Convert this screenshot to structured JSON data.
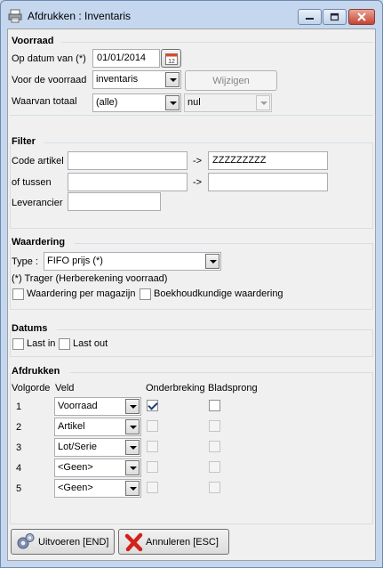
{
  "window": {
    "title": "Afdrukken : Inventaris",
    "minimize_icon": "minimize-icon",
    "maximize_icon": "maximize-icon",
    "close_icon": "close-icon"
  },
  "voorraad": {
    "title": "Voorraad",
    "op_datum_label": "Op datum van (*)",
    "op_datum_value": "01/01/2014",
    "voor_label": "Voor de voorraad",
    "voor_value": "inventaris",
    "wijzigen_label": "Wijzigen",
    "waarvan_label": "Waarvan totaal",
    "waarvan_value": "(alle)",
    "waarvan_op_value": "nul"
  },
  "filter": {
    "title": "Filter",
    "code_label": "Code artikel",
    "code_from": "",
    "arrow": "->",
    "code_to": "ZZZZZZZZZ",
    "tussen_label": "of tussen",
    "tussen_from": "",
    "tussen_to": "",
    "leverancier_label": "Leverancier",
    "leverancier_value": ""
  },
  "waardering": {
    "title": "Waardering",
    "type_label": "Type :",
    "type_value": "FIFO prijs (*)",
    "note": "(*) Trager (Herberekening voorraad)",
    "per_magazijn_label": "Waardering per magazijn",
    "per_magazijn_checked": false,
    "boekhoud_label": "Boekhoudkundige waardering",
    "boekhoud_checked": false
  },
  "datums": {
    "title": "Datums",
    "last_in_label": "Last in",
    "last_out_label": "Last out"
  },
  "afdrukken": {
    "title": "Afdrukken",
    "col_volgorde": "Volgorde",
    "col_veld": "Veld",
    "col_onderbreking": "Onderbreking",
    "col_bladsprong": "Bladsprong",
    "rows": [
      {
        "nr": "1",
        "veld": "Voorraad",
        "onderbreking": true,
        "bladsprong": false
      },
      {
        "nr": "2",
        "veld": "Artikel",
        "onderbreking": false,
        "bladsprong": false
      },
      {
        "nr": "3",
        "veld": "Lot/Serie",
        "onderbreking": false,
        "bladsprong": false
      },
      {
        "nr": "4",
        "veld": "<Geen>",
        "onderbreking": false,
        "bladsprong": false
      },
      {
        "nr": "5",
        "veld": "<Geen>",
        "onderbreking": false,
        "bladsprong": false
      }
    ]
  },
  "footer": {
    "uitvoeren_label": "Uitvoeren [END]",
    "uitvoeren_icon": "gears-icon",
    "annuleren_label": "Annuleren [ESC]",
    "annuleren_icon": "cancel-x-icon"
  }
}
